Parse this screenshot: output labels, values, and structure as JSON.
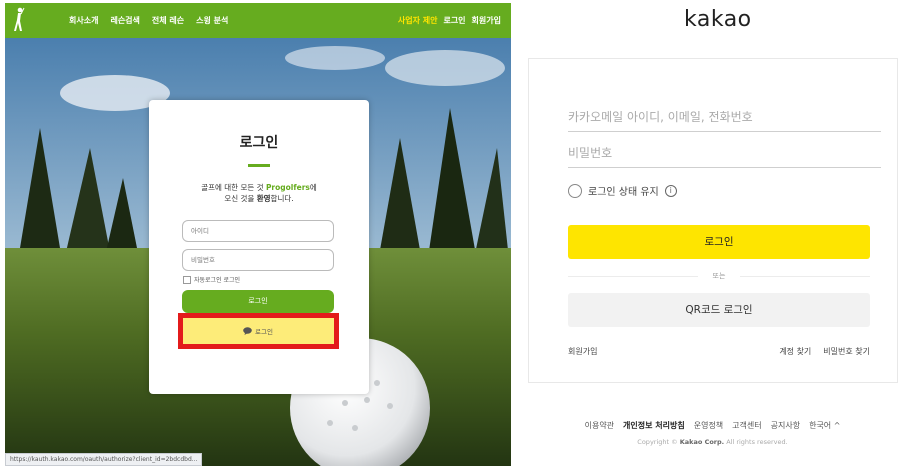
{
  "left": {
    "nav": {
      "items": [
        "회사소개",
        "레슨검색",
        "전체 레슨",
        "스윙 분석"
      ],
      "right": [
        "사업자 제안",
        "로그인",
        "회원가입"
      ]
    },
    "card": {
      "title": "로그인",
      "welcome_pre": "골프에 대한 모든 것 ",
      "brand": "Progolfers",
      "welcome_post": "에",
      "welcome2_pre": "오신 것을 ",
      "welcome2_bold": "환영",
      "welcome2_post": "합니다.",
      "id_placeholder": "아이디",
      "pw_placeholder": "비밀번호",
      "auto_login": "자동로그인 로그인",
      "login_button": "로그인",
      "kakao_button": "로그인"
    },
    "status_url": "https://kauth.kakao.com/oauth/authorize?client_id=2bdcdbd..."
  },
  "right": {
    "logo": "kakao",
    "id_placeholder": "카카오메일 아이디, 이메일, 전화번호",
    "pw_placeholder": "비밀번호",
    "keep_login": "로그인 상태 유지",
    "info_icon": "i",
    "login_button": "로그인",
    "or": "또는",
    "qr_button": "QR코드 로그인",
    "signup": "회원가입",
    "find_account": "계정 찾기",
    "find_password": "비밀번호 찾기",
    "footer": {
      "terms": "이용약관",
      "privacy": "개인정보 처리방침",
      "policy": "운영정책",
      "support": "고객센터",
      "notice": "공지사항",
      "language": "한국어 ^"
    },
    "copyright_pre": "Copyright © ",
    "copyright_brand": "Kakao Corp.",
    "copyright_post": " All rights reserved."
  },
  "colors": {
    "green": "#66ac1f",
    "kakao_yellow": "#fee500",
    "kakao_button_light": "#fdec79",
    "highlight_red": "#e31b1b"
  },
  "icons": [
    "golfer-logo-icon",
    "chat-bubble-icon",
    "info-icon"
  ]
}
